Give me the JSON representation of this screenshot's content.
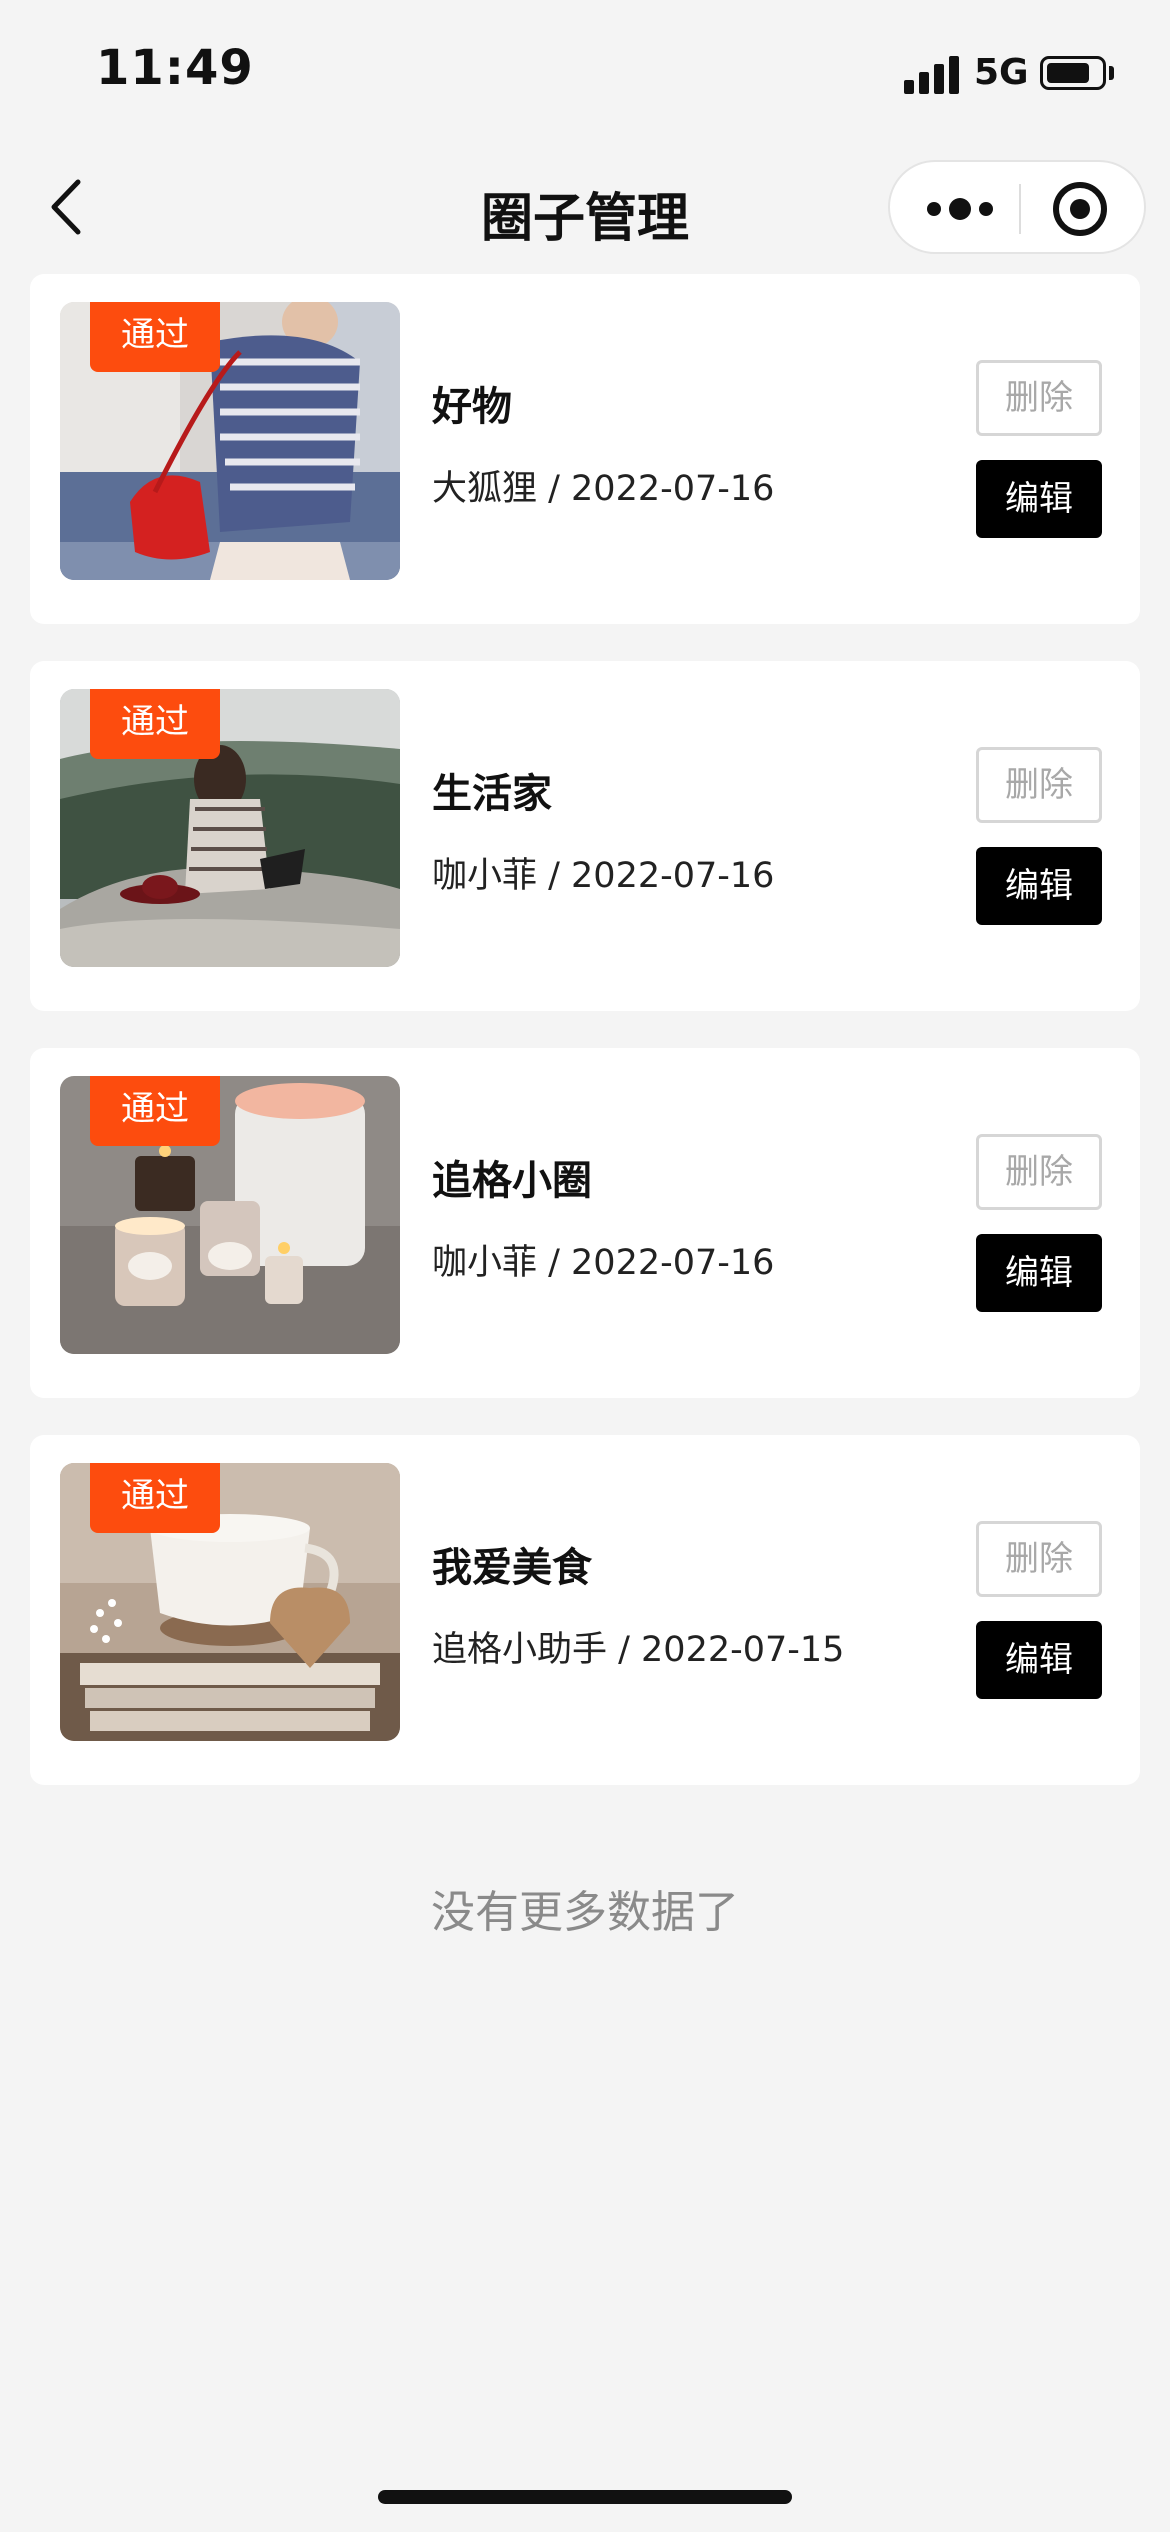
{
  "status_bar": {
    "time": "11:49",
    "network": "5G"
  },
  "nav": {
    "title": "圈子管理"
  },
  "colors": {
    "badge": "#fd4c0e",
    "edit_button": "#000000",
    "background": "#f4f4f4"
  },
  "icons": {
    "back": "chevron-left-icon",
    "more": "more-dots-icon",
    "close": "target-circle-icon"
  },
  "circles": [
    {
      "badge": "通过",
      "title": "好物",
      "meta": "大狐狸 / 2022-07-16",
      "delete_label": "删除",
      "edit_label": "编辑"
    },
    {
      "badge": "通过",
      "title": "生活家",
      "meta": "咖小菲 / 2022-07-16",
      "delete_label": "删除",
      "edit_label": "编辑"
    },
    {
      "badge": "通过",
      "title": "追格小圈",
      "meta": "咖小菲 / 2022-07-16",
      "delete_label": "删除",
      "edit_label": "编辑"
    },
    {
      "badge": "通过",
      "title": "我爱美食",
      "meta": "追格小助手 / 2022-07-15",
      "delete_label": "删除",
      "edit_label": "编辑"
    }
  ],
  "footer": {
    "no_more": "没有更多数据了"
  }
}
